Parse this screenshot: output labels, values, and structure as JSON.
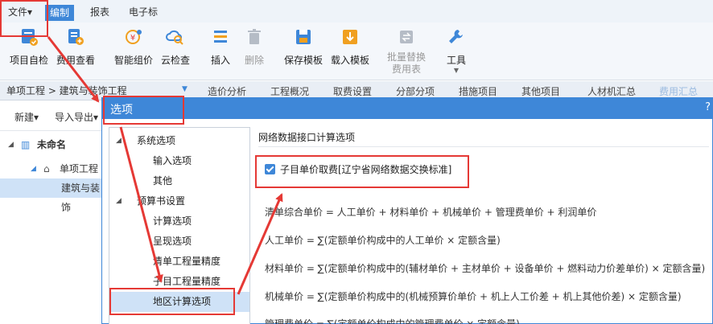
{
  "menubar": {
    "items": [
      {
        "label": "文件▾"
      },
      {
        "label": "编制"
      },
      {
        "label": "报表"
      },
      {
        "label": "电子标"
      }
    ]
  },
  "toolbar": {
    "tools": [
      {
        "label": "项目自检",
        "icon": "project-check-icon"
      },
      {
        "label": "费用查看",
        "icon": "cost-view-icon"
      },
      {
        "label": "智能组价",
        "icon": "smart-pricing-icon"
      },
      {
        "label": "云检查",
        "icon": "cloud-check-icon"
      },
      {
        "label": "插入",
        "icon": "insert-icon"
      },
      {
        "label": "删除",
        "icon": "delete-icon"
      },
      {
        "label": "保存模板",
        "icon": "save-template-icon"
      },
      {
        "label": "载入模板",
        "icon": "load-template-icon"
      },
      {
        "label": "批量替换",
        "label2": "费用表",
        "icon": "batch-replace-icon"
      },
      {
        "label": "工具",
        "icon": "tools-icon"
      }
    ]
  },
  "breadcrumb": "单项工程 > 建筑与装饰工程",
  "tabs": [
    "造价分析",
    "工程概况",
    "取费设置",
    "分部分项",
    "措施项目",
    "其他项目",
    "人材机汇总",
    "费用汇总"
  ],
  "leftpanel": {
    "new_label": "新建▾",
    "import_label": "导入导出▾",
    "tree": [
      {
        "label": "未命名"
      },
      {
        "label": "单项工程"
      },
      {
        "label": "建筑与装饰"
      }
    ]
  },
  "dialog": {
    "title": "选项",
    "help": "?",
    "tree": {
      "system": "系统选项",
      "input": "输入选项",
      "other": "其他",
      "budget": "预算书设置",
      "calc": "计算选项",
      "display": "呈现选项",
      "list_precision": "清单工程量精度",
      "sub_precision": "子目工程量精度",
      "regional": "地区计算选项"
    },
    "content": {
      "section_title": "网络数据接口计算选项",
      "checkbox_label": "子目单价取费[辽宁省网络数据交换标准]",
      "checkbox_checked": true,
      "formulas": [
        "清单综合单价 = 人工单价 + 材料单价 + 机械单价 + 管理费单价 + 利润单价",
        "人工单价 = ∑(定额单价构成中的人工单价 × 定额含量)",
        "材料单价 = ∑(定额单价构成中的(辅材单价 + 主材单价 + 设备单价 + 燃料动力价差单价) × 定额含量)",
        "机械单价 = ∑(定额单价构成中的(机械预算价单价 + 机上人工价差 + 机上其他价差) × 定额含量)",
        "管理费单价 = ∑(定额单价构成中的管理费单价 × 定额含量)"
      ]
    }
  },
  "colors": {
    "accent": "#3e87d8",
    "annotation": "#e53935",
    "selection": "#cfe2f7"
  }
}
